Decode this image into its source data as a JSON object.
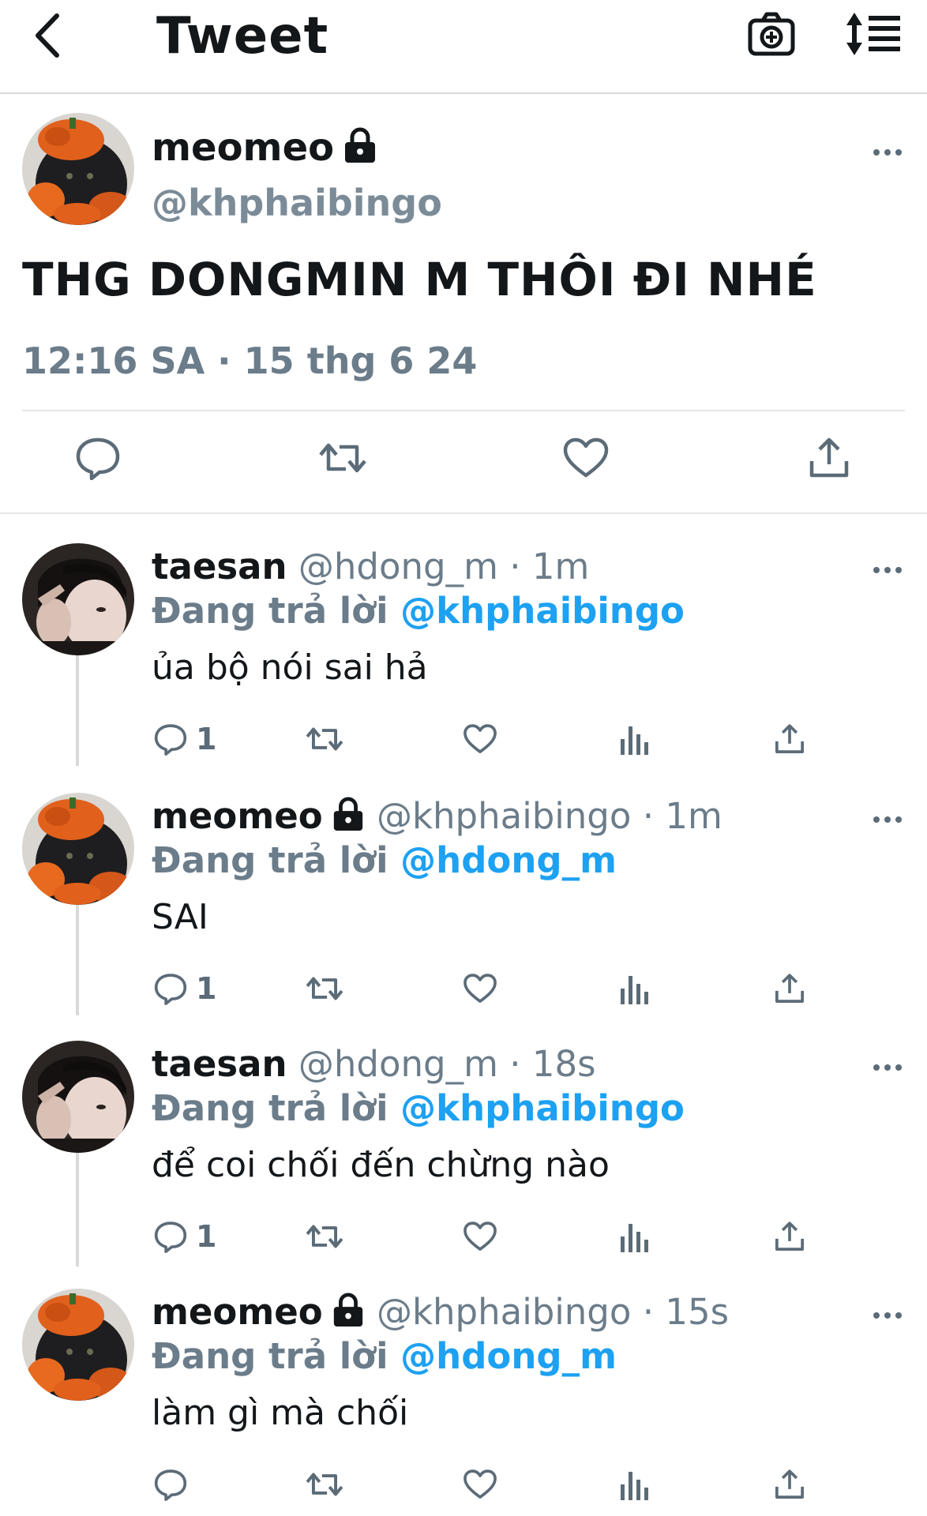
{
  "header": {
    "title": "Tweet",
    "icons": [
      "back-arrow-icon",
      "camera-plus-icon",
      "sort-icon"
    ]
  },
  "main_tweet": {
    "name": "meomeo",
    "handle": "@khphaibingo",
    "text": "THG DONGMIN M THÔI ĐI NHÉ",
    "meta": "12:16 SA · 15 thg 6 24",
    "icons": [
      "reply-icon",
      "retweet-icon",
      "like-icon",
      "share-icon",
      "lock-icon",
      "more-icon"
    ]
  },
  "replies": [
    {
      "name": "taesan",
      "handle": "@hdong_m",
      "sep": " · ",
      "time": "1m",
      "replying_label": "Đang trả lời ",
      "replying_to": "@khphaibingo",
      "text": "ủa bộ nói sai hả",
      "reply_count": "1",
      "locked": false
    },
    {
      "name": "meomeo",
      "handle": "@khphaibingo",
      "sep": " · ",
      "time": "1m",
      "replying_label": "Đang trả lời ",
      "replying_to": "@hdong_m",
      "text": "SAI",
      "reply_count": "1",
      "locked": true
    },
    {
      "name": "taesan",
      "handle": "@hdong_m",
      "sep": " · ",
      "time": "18s",
      "replying_label": "Đang trả lời ",
      "replying_to": "@khphaibingo",
      "text": "để coi chối đến chừng nào",
      "reply_count": "1",
      "locked": false
    },
    {
      "name": "meomeo",
      "handle": "@khphaibingo",
      "sep": " · ",
      "time": "15s",
      "replying_label": "Đang trả lời ",
      "replying_to": "@hdong_m",
      "text": "làm gì mà chối",
      "reply_count": "",
      "locked": true
    }
  ],
  "colors": {
    "accent": "#1da1f2",
    "muted": "#6b7c8a",
    "text": "#14171a",
    "icon": "#5b6b78",
    "divider": "#e6e6e6"
  }
}
